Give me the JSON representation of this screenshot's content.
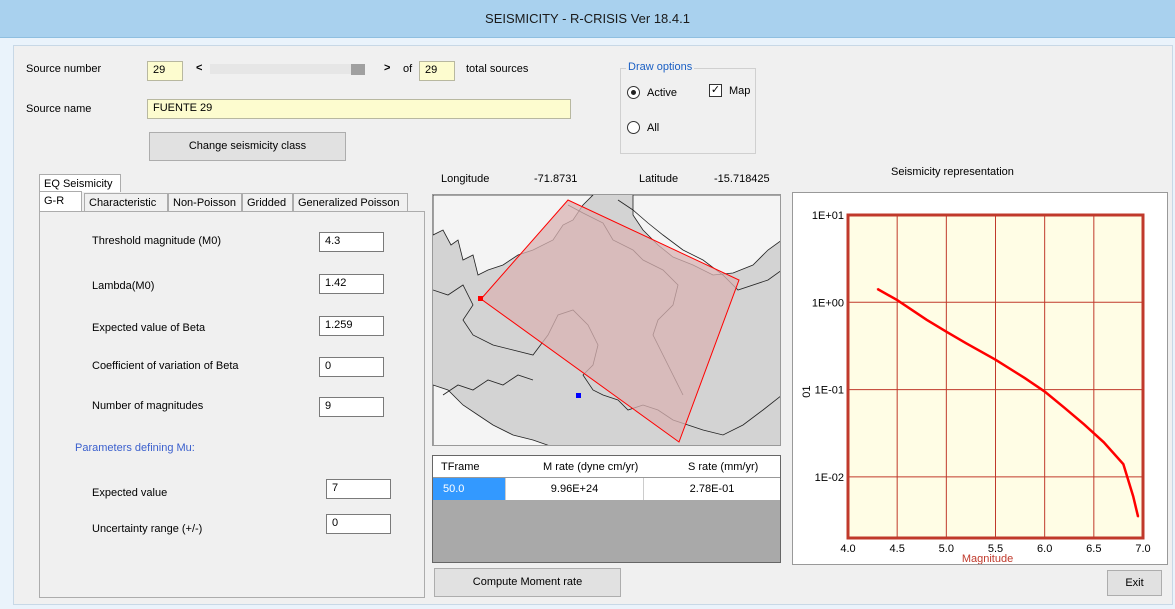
{
  "window": {
    "title": "SEISMICITY - R-CRISIS Ver 18.4.1"
  },
  "source": {
    "number_label": "Source number",
    "number_value": "29",
    "prev_arrow": "<",
    "next_arrow": ">",
    "of_label": "of",
    "total_value": "29",
    "total_label": "total sources",
    "name_label": "Source name",
    "name_value": "FUENTE 29",
    "change_class_label": "Change seismicity class"
  },
  "draw_options": {
    "title": "Draw options",
    "active_label": "Active",
    "all_label": "All",
    "map_label": "Map",
    "active_selected": true,
    "map_checked": true
  },
  "coords": {
    "longitude_label": "Longitude",
    "longitude_value": "-71.8731",
    "latitude_label": "Latitude",
    "latitude_value": "-15.718425"
  },
  "tabs": {
    "outer": [
      "EQ Seismicity"
    ],
    "inner": [
      "G-R",
      "Characteristic",
      "Non-Poisson",
      "Gridded",
      "Generalized Poisson"
    ],
    "active_inner": "G-R"
  },
  "params": {
    "threshold_label": "Threshold magnitude (M0)",
    "threshold_value": "4.3",
    "lambda_label": "Lambda(M0)",
    "lambda_value": "1.42",
    "beta_label": "Expected value of Beta",
    "beta_value": "1.259",
    "cv_label": "Coefficient of variation of Beta",
    "cv_value": "0",
    "nmag_label": "Number of magnitudes",
    "nmag_value": "9",
    "mu_heading": "Parameters defining Mu:",
    "expected_label": "Expected value",
    "expected_value": "7",
    "uncert_label": "Uncertainty range (+/-)",
    "uncert_value": "0"
  },
  "moment_table": {
    "headers": [
      "TFrame",
      "M rate (dyne cm/yr)",
      "S rate (mm/yr)"
    ],
    "rows": [
      [
        "50.0",
        "9.96E+24",
        "2.78E-01"
      ]
    ]
  },
  "compute_button": "Compute Moment rate",
  "exit_button": "Exit",
  "chart_panel_title": "Seismicity representation",
  "chart_data": {
    "type": "line",
    "xlabel": "Magnitude",
    "ylabel": "01",
    "x_ticks": [
      "4.0",
      "4.5",
      "5.0",
      "5.5",
      "6.0",
      "6.5",
      "7.0"
    ],
    "y_ticks": [
      "1E+01",
      "1E+00",
      "1E-01",
      "1E-02"
    ],
    "xlim": [
      4.0,
      7.0
    ],
    "ylim_log10": [
      -2.7,
      1
    ],
    "log_y": true,
    "grid": true,
    "series": [
      {
        "color": "#ff0000",
        "x": [
          4.3,
          4.5,
          4.8,
          5.0,
          5.2,
          5.5,
          5.8,
          6.0,
          6.2,
          6.4,
          6.6,
          6.8,
          6.9,
          6.95
        ],
        "y": [
          1.42,
          1.06,
          0.63,
          0.46,
          0.34,
          0.22,
          0.135,
          0.095,
          0.062,
          0.04,
          0.025,
          0.014,
          0.006,
          0.0035
        ]
      }
    ]
  },
  "colors": {
    "chart_border": "#c0392b",
    "chart_bg": "#fffde5",
    "map_bg": "#d3d3d3",
    "source_fill": "#d9b3b3",
    "source_outline": "#ff0000",
    "selected_cell": "#3399ff"
  }
}
